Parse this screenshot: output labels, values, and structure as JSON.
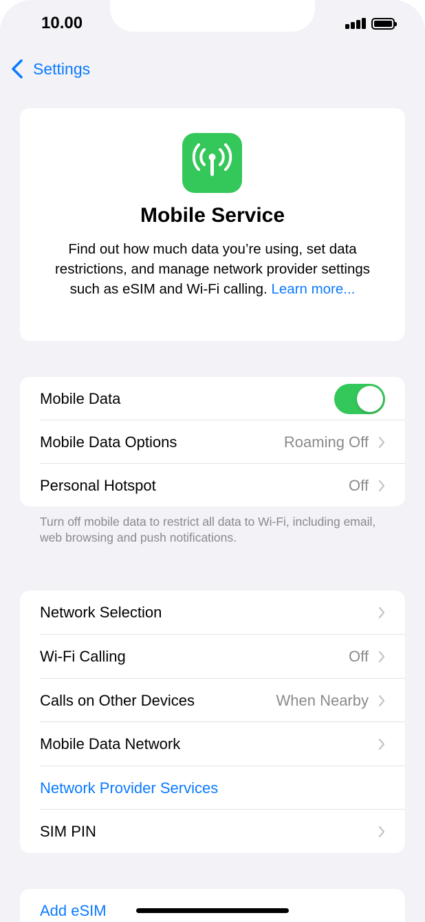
{
  "status_bar": {
    "time": "10.00"
  },
  "nav": {
    "back_label": "Settings"
  },
  "hero": {
    "icon": "antenna-signal-icon",
    "title": "Mobile Service",
    "description": "Find out how much data you’re using, set data restrictions, and manage network provider settings such as eSIM and Wi-Fi calling.",
    "link": "Learn more..."
  },
  "data_group": {
    "rows": [
      {
        "label": "Mobile Data",
        "toggle_on": true
      },
      {
        "label": "Mobile Data Options",
        "value": "Roaming Off"
      },
      {
        "label": "Personal Hotspot",
        "value": "Off"
      }
    ],
    "footnote": "Turn off mobile data to restrict all data to Wi-Fi, including email, web browsing and push notifications."
  },
  "network_group": {
    "rows": [
      {
        "label": "Network Selection"
      },
      {
        "label": "Wi-Fi Calling",
        "value": "Off"
      },
      {
        "label": "Calls on Other Devices",
        "value": "When Nearby"
      },
      {
        "label": "Mobile Data Network"
      },
      {
        "label": "Network Provider Services"
      },
      {
        "label": "SIM PIN"
      }
    ]
  },
  "esim_group": {
    "add_label": "Add eSIM"
  },
  "colors": {
    "accent": "#0a7aff",
    "toggle_on": "#34c759",
    "icon_bg": "#34c759",
    "background": "#f2f2f7",
    "secondary_text": "#8a8a8e"
  }
}
